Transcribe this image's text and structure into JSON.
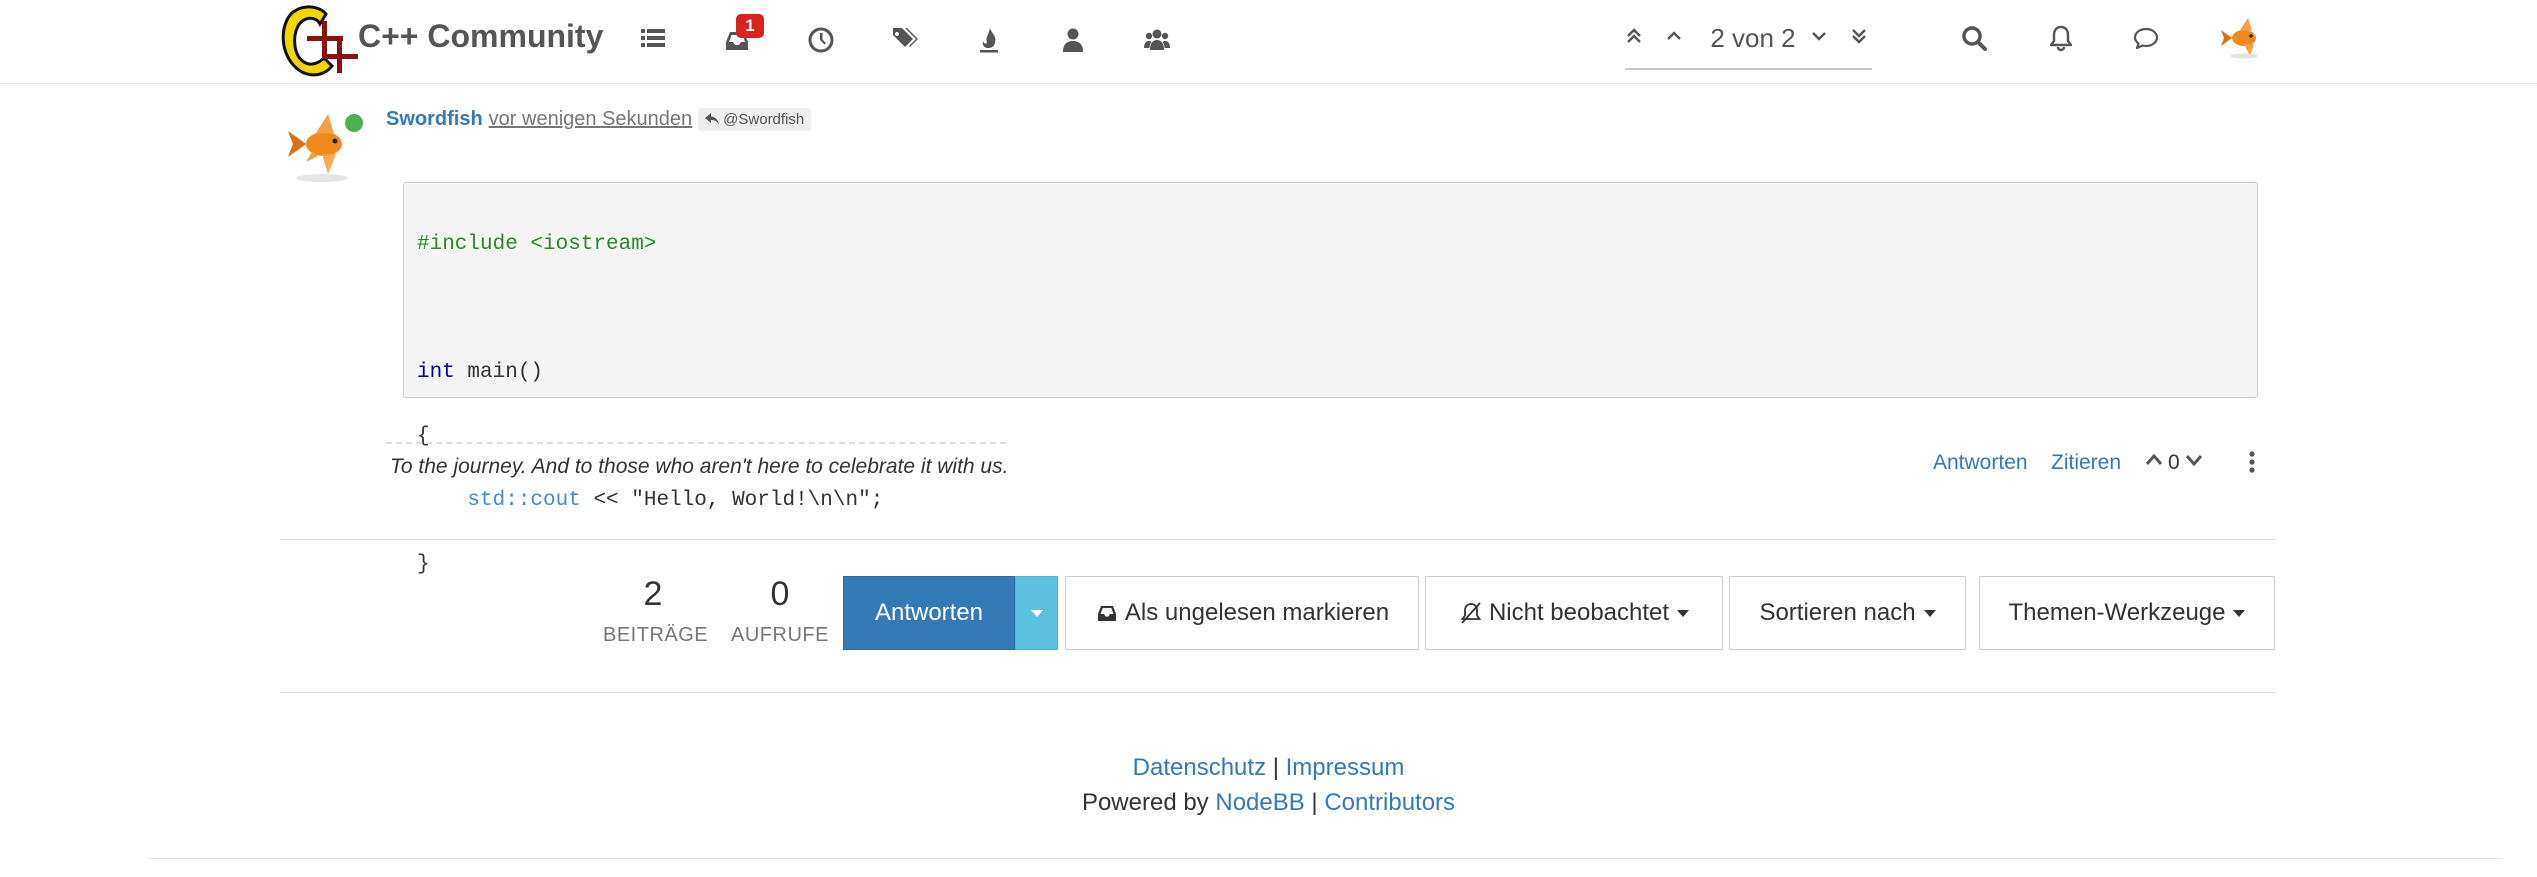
{
  "header": {
    "brand": "C++ Community",
    "unread_badge": "1",
    "pagination": "2 von 2"
  },
  "post": {
    "username": "Swordfish",
    "timeago": "vor wenigen Sekunden",
    "reply_to": "@Swordfish",
    "code_lines": [
      "#include <iostream>",
      "",
      "int main()",
      "{",
      "    std::cout << \"Hello, World!\\n\\n\";",
      "}"
    ],
    "code_tokens": {
      "include": "#include <iostream>",
      "kw_int": "int",
      "main_sig": " main()",
      "open_brace": "{",
      "indent": "    ",
      "std_cout": "std::cout",
      "cout_rest": " << \"Hello, World!\\n\\n\";",
      "close_brace": "}"
    },
    "signature": "To the journey. And to those who aren't here to celebrate it with us.",
    "reply_link": "Antworten",
    "quote_link": "Zitieren",
    "votes": "0"
  },
  "stats": {
    "posts_count": "2",
    "posts_label": "Beiträge",
    "views_count": "0",
    "views_label": "Aufrufe"
  },
  "toolbar": {
    "reply_button": "Antworten",
    "mark_unread": "Als ungelesen markieren",
    "watch": "Nicht beobachtet",
    "sort": "Sortieren nach",
    "tools": "Themen-Werkzeuge"
  },
  "footer": {
    "privacy": "Datenschutz",
    "separator": "|",
    "imprint": "Impressum",
    "powered_by": "Powered by",
    "nodebb": "NodeBB",
    "contributors": "Contributors"
  },
  "colors": {
    "link": "#337ab7",
    "primary": "#337ab7",
    "caret_button": "#5bc0de",
    "badge": "#d9231f",
    "online": "#4caf50"
  },
  "icons": {
    "nav": [
      "list-icon",
      "inbox-icon",
      "clock-icon",
      "tags-icon",
      "fire-icon",
      "user-icon",
      "users-icon"
    ],
    "right": [
      "search-icon",
      "bell-icon",
      "chat-icon"
    ],
    "pagination": [
      "double-chevron-up-icon",
      "chevron-up-icon",
      "chevron-down-icon",
      "double-chevron-down-icon"
    ]
  }
}
